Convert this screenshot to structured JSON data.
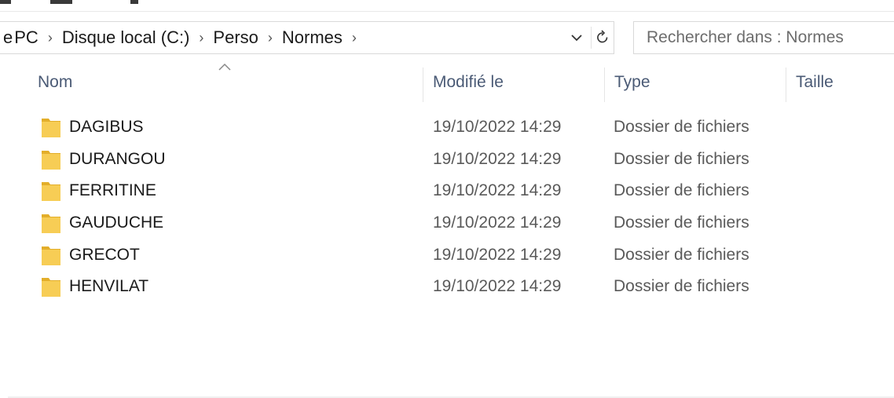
{
  "address_bar": {
    "crumbs": [
      "PC",
      "Disque local (C:)",
      "Perso",
      "Normes"
    ],
    "prefix": "e",
    "dropdown_icon": "chevron-down-icon",
    "refresh_icon": "refresh-icon"
  },
  "search": {
    "placeholder": "Rechercher dans : Normes"
  },
  "columns": {
    "name": "Nom",
    "modified": "Modifié le",
    "type": "Type",
    "size": "Taille",
    "sort_icon": "sort-ascending-icon"
  },
  "files": [
    {
      "name": "DAGIBUS",
      "modified": "19/10/2022 14:29",
      "type": "Dossier de fichiers",
      "size": ""
    },
    {
      "name": "DURANGOU",
      "modified": "19/10/2022 14:29",
      "type": "Dossier de fichiers",
      "size": ""
    },
    {
      "name": "FERRITINE",
      "modified": "19/10/2022 14:29",
      "type": "Dossier de fichiers",
      "size": ""
    },
    {
      "name": "GAUDUCHE",
      "modified": "19/10/2022 14:29",
      "type": "Dossier de fichiers",
      "size": ""
    },
    {
      "name": "GRECOT",
      "modified": "19/10/2022 14:29",
      "type": "Dossier de fichiers",
      "size": ""
    },
    {
      "name": "HENVILAT",
      "modified": "19/10/2022 14:29",
      "type": "Dossier de fichiers",
      "size": ""
    }
  ],
  "colors": {
    "folder": "#f5c94c",
    "folder_dark": "#e3ae2a",
    "header_text": "#4a5a75",
    "meta_text": "#5a5a5a"
  }
}
